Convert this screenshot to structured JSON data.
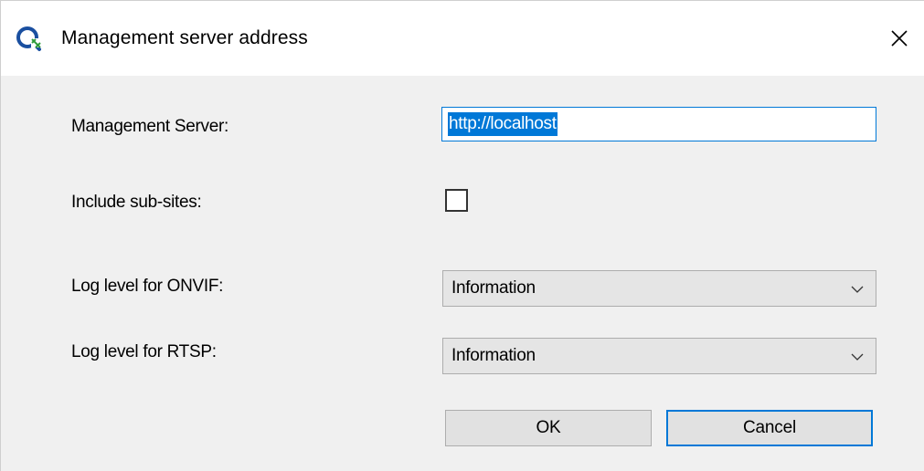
{
  "window": {
    "title": "Management server address",
    "icon": "app-icon",
    "close_icon": "close-icon"
  },
  "form": {
    "server_label": "Management Server:",
    "server_value": "http://localhost",
    "subsites_label": "Include sub-sites:",
    "subsites_checked": false,
    "onvif_label": "Log level for ONVIF:",
    "onvif_value": "Information",
    "rtsp_label": "Log level for RTSP:",
    "rtsp_value": "Information"
  },
  "buttons": {
    "ok_label": "OK",
    "cancel_label": "Cancel"
  },
  "colors": {
    "accent": "#0078d7",
    "dialog_bg": "#f0f0f0",
    "button_bg": "#e1e1e1"
  }
}
